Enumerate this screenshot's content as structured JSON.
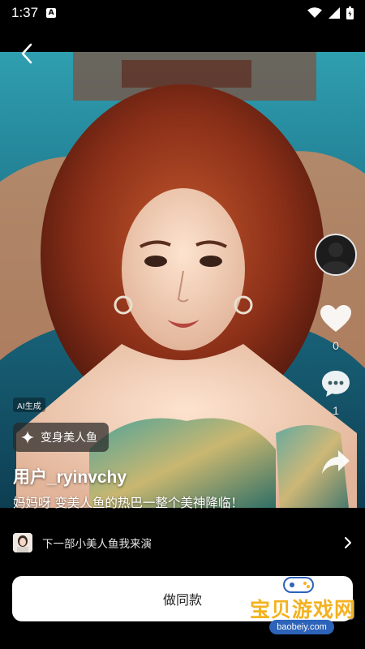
{
  "status": {
    "time": "1:37"
  },
  "post": {
    "ai_badge": "AI生成",
    "effect_label": "变身美人鱼",
    "username": "用户_ryinvchy",
    "caption": "妈妈呀 变美人鱼的热巴一整个美神降临！"
  },
  "actions": {
    "like_count": "0",
    "comment_count": "1"
  },
  "related": {
    "label": "下一部小美人鱼我来演"
  },
  "cta": {
    "label": "做同款"
  },
  "watermark": {
    "text": "宝贝游戏网",
    "url": "baobeiy.com"
  },
  "colors": {
    "accent_watermark": "#f3b21f",
    "watermark_url_bg": "#2d63b8",
    "cta_bg": "#ffffff"
  },
  "icons": [
    "back-arrow-icon",
    "heart-icon",
    "comment-icon",
    "share-icon",
    "sparkle-icon",
    "chevron-right-icon",
    "wifi-icon",
    "signal-icon",
    "battery-icon"
  ]
}
